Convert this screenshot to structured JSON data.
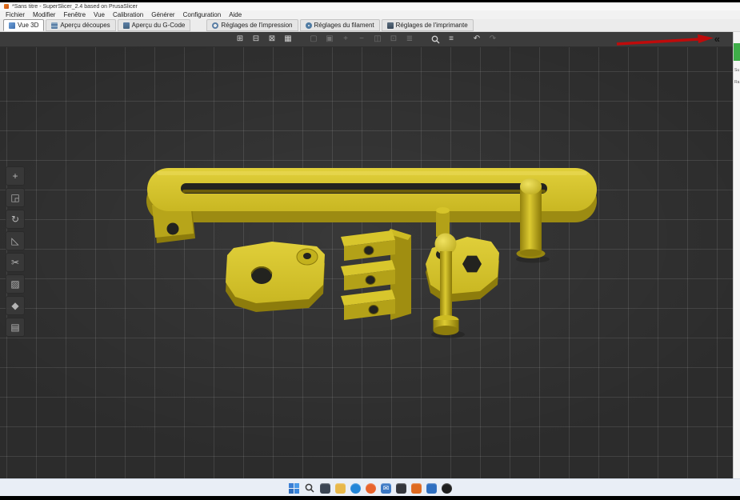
{
  "window": {
    "title": "*Sans titre - SuperSlicer_2.4  based on PrusaSlicer"
  },
  "menubar": {
    "items": [
      "Fichier",
      "Modifier",
      "Fenêtre",
      "Vue",
      "Calibration",
      "Générer",
      "Configuration",
      "Aide"
    ]
  },
  "tabbar": {
    "view_tabs": [
      {
        "label": "Vue 3D",
        "active": true
      },
      {
        "label": "Aperçu découpes",
        "active": false
      },
      {
        "label": "Aperçu du G-Code",
        "active": false
      }
    ],
    "settings_tabs": [
      {
        "label": "Réglages de l'impression"
      },
      {
        "label": "Réglages du filament"
      },
      {
        "label": "Réglages de l'imprimante"
      }
    ]
  },
  "viewport_toolbar": {
    "icons": [
      {
        "name": "add-object",
        "glyph": "⊞",
        "enabled": true
      },
      {
        "name": "delete-object",
        "glyph": "⊟",
        "enabled": true
      },
      {
        "name": "delete-all",
        "glyph": "⊠",
        "enabled": true
      },
      {
        "name": "arrange",
        "glyph": "▦",
        "enabled": true
      },
      {
        "name": "copy",
        "glyph": "▢",
        "enabled": false
      },
      {
        "name": "paste",
        "glyph": "▣",
        "enabled": false
      },
      {
        "name": "add-instance",
        "glyph": "+",
        "enabled": false
      },
      {
        "name": "remove-instance",
        "glyph": "−",
        "enabled": false
      },
      {
        "name": "split-to-objects",
        "glyph": "◫",
        "enabled": false
      },
      {
        "name": "split-to-parts",
        "glyph": "⊡",
        "enabled": false
      },
      {
        "name": "variable-layer-height",
        "glyph": "≣",
        "enabled": false
      },
      {
        "name": "search",
        "glyph": "⌕",
        "enabled": true
      },
      {
        "name": "layers-list",
        "glyph": "≡",
        "enabled": true
      },
      {
        "name": "undo",
        "glyph": "↶",
        "enabled": true
      },
      {
        "name": "redo",
        "glyph": "↷",
        "enabled": false
      }
    ]
  },
  "left_toolbar": {
    "icons": [
      {
        "name": "move",
        "glyph": "+"
      },
      {
        "name": "scale",
        "glyph": "◲"
      },
      {
        "name": "rotate",
        "glyph": "↻"
      },
      {
        "name": "place-on-face",
        "glyph": "◺"
      },
      {
        "name": "cut",
        "glyph": "✂"
      },
      {
        "name": "paint-supports",
        "glyph": "▨"
      },
      {
        "name": "seam-position",
        "glyph": "◆"
      },
      {
        "name": "variable-layers",
        "glyph": "▤"
      }
    ]
  },
  "right_panel": {
    "collapse_glyph": "«",
    "fragments": [
      "Su",
      "Ra"
    ]
  },
  "taskbar": {
    "icons": [
      {
        "name": "start",
        "color": "#3b7fd4"
      },
      {
        "name": "search",
        "color": "#2e2e2e"
      },
      {
        "name": "task-view",
        "color": "#3c4654"
      },
      {
        "name": "file-explorer",
        "color": "#e8b84b"
      },
      {
        "name": "edge-browser",
        "color": "#2386d8"
      },
      {
        "name": "firefox-browser",
        "color": "#e8632c"
      },
      {
        "name": "mail",
        "color": "#3b78c4",
        "glyph": "✉"
      },
      {
        "name": "app-dark",
        "color": "#34363c"
      },
      {
        "name": "superslicer",
        "color": "#df6b21"
      },
      {
        "name": "app-blue",
        "color": "#2f6fc0"
      },
      {
        "name": "app-black",
        "color": "#1f1f1f"
      }
    ]
  },
  "colors": {
    "model_yellow": "#d8c62c",
    "model_shadow": "#8d7c0c",
    "bed": "#2c2c2c",
    "grid_line": "#4a4a4a",
    "annotation_red": "#bf0b0b",
    "panel_green": "#3fae49"
  }
}
